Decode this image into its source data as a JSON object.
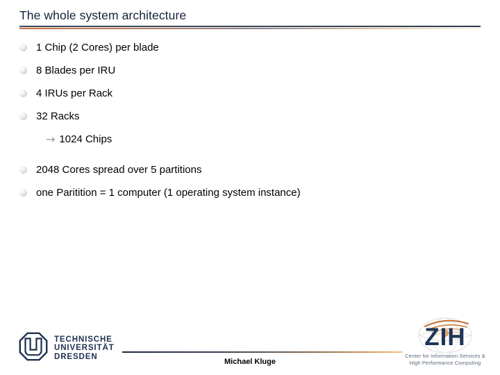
{
  "slide": {
    "title": "The whole system architecture",
    "footer_author": "Michael Kluge"
  },
  "bullets": [
    {
      "text": "1 Chip (2 Cores) per blade"
    },
    {
      "text": "8 Blades per IRU"
    },
    {
      "text": "4 IRUs per Rack"
    },
    {
      "text": "32 Racks"
    }
  ],
  "sub_bullet": {
    "arrow": "→",
    "text": "1024 Chips"
  },
  "bullets_after": [
    {
      "text": "2048 Cores spread over 5 partitions"
    },
    {
      "text": "one Paritition = 1 computer (1 operating system instance)"
    }
  ],
  "tud_logo": {
    "line1": "TECHNISCHE",
    "line2": "UNIVERSITÄT",
    "line3": "DRESDEN"
  },
  "zih_logo": {
    "wordmark": "ZIH",
    "tagline_line1": "Center for Information Services &",
    "tagline_line2": "High Performance Computing"
  },
  "colors": {
    "title_text": "#16213c",
    "rule_dark": "#3c4656",
    "rule_orange": "#c8703f",
    "tud_navy": "#1d3050",
    "zih_navy": "#1f3557",
    "zih_tag_gray": "#5a6676",
    "bullet_gray": "#cfcfcf",
    "arrow_gray": "#9a9a9a"
  }
}
